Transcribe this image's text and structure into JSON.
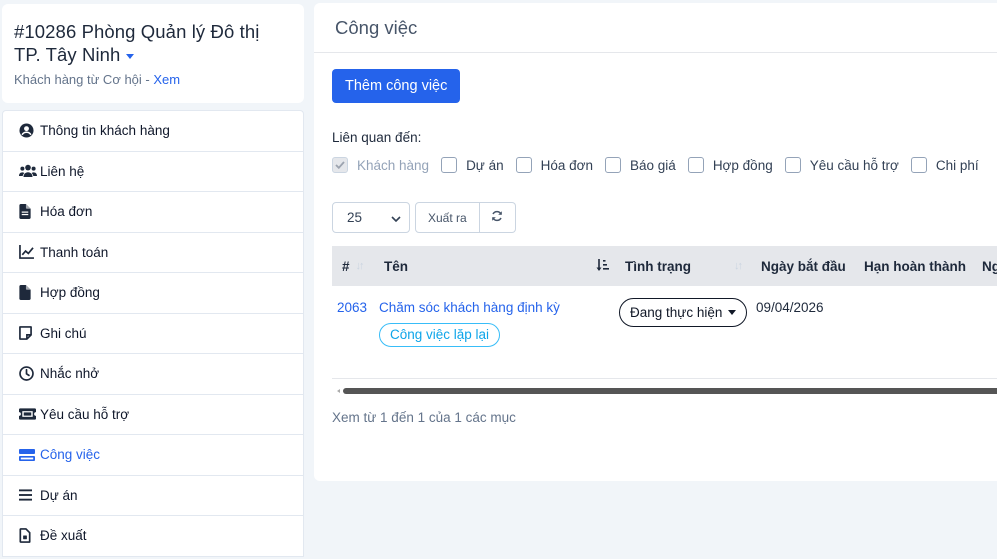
{
  "client": {
    "title_line1": "#10286 Phòng Quản lý Đô thị",
    "title_line2": "TP. Tây Ninh",
    "subtitle": "Khách hàng từ Cơ hội",
    "separator": " - ",
    "view_link": "Xem"
  },
  "sidebar": {
    "items": [
      {
        "label": "Thông tin khách hàng",
        "icon": "user-circle-icon"
      },
      {
        "label": "Liên hệ",
        "icon": "users-icon"
      },
      {
        "label": "Hóa đơn",
        "icon": "file-text-icon"
      },
      {
        "label": "Thanh toán",
        "icon": "line-chart-icon"
      },
      {
        "label": "Hợp đồng",
        "icon": "file-icon"
      },
      {
        "label": "Ghi chú",
        "icon": "sticky-note-icon"
      },
      {
        "label": "Nhắc nhở",
        "icon": "clock-icon"
      },
      {
        "label": "Yêu cầu hỗ trợ",
        "icon": "ticket-icon"
      },
      {
        "label": "Công việc",
        "icon": "tasks-icon",
        "active": true
      },
      {
        "label": "Dự án",
        "icon": "bars-icon"
      },
      {
        "label": "Đề xuất",
        "icon": "file-proposal-icon"
      }
    ]
  },
  "main": {
    "title": "Công việc",
    "add_button": "Thêm công việc",
    "related_label": "Liên quan đến:",
    "filters": [
      {
        "label": "Khách hàng",
        "checked": true,
        "disabled": true
      },
      {
        "label": "Dự án",
        "checked": false
      },
      {
        "label": "Hóa đơn",
        "checked": false
      },
      {
        "label": "Báo giá",
        "checked": false
      },
      {
        "label": "Hợp đồng",
        "checked": false
      },
      {
        "label": "Yêu cầu hỗ trợ",
        "checked": false
      },
      {
        "label": "Chi phí",
        "checked": false
      }
    ],
    "page_size": "25",
    "export_label": "Xuất ra",
    "table": {
      "headers": [
        "#",
        "Tên",
        "Tình trạng",
        "Ngày bắt đầu",
        "Hạn hoàn thành",
        "Ng"
      ],
      "rows": [
        {
          "id": "2063",
          "name": "Chăm sóc khách hàng định kỳ",
          "tag": "Công việc lặp lại",
          "status": "Đang thực hiện",
          "start_date": "09/04/2026",
          "due_date": ""
        }
      ]
    },
    "summary": "Xem từ 1 đến 1 của 1 các mục"
  },
  "colors": {
    "accent": "#2563eb",
    "recurring_tag": "#0ea5e9",
    "header_bg": "#e5e7eb",
    "page_bg": "#f1f5f9"
  }
}
